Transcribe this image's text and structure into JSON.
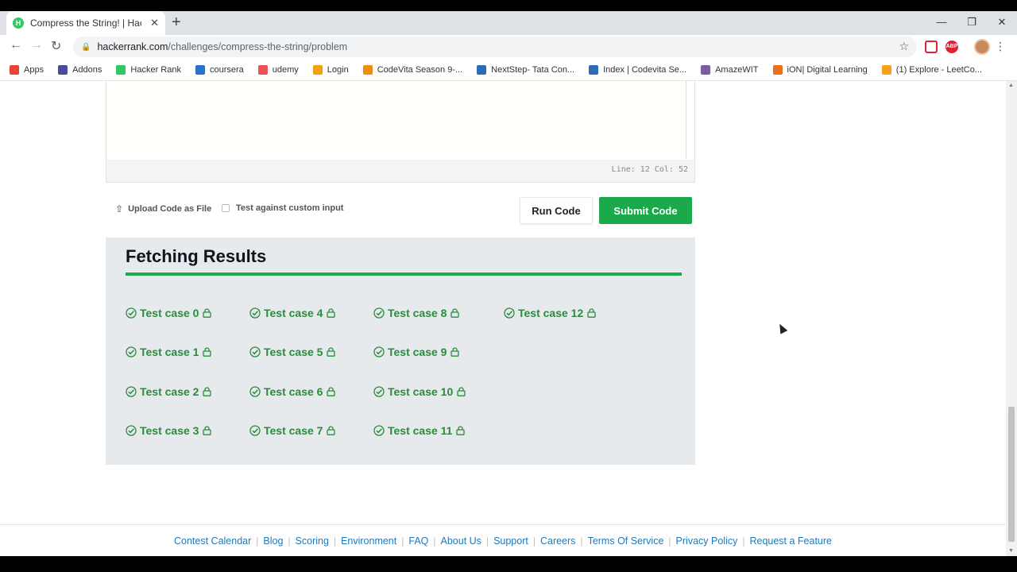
{
  "browser": {
    "tab_title": "Compress the String! | HackerRank",
    "favicon_letter": "H",
    "new_tab": "+",
    "close_tab": "✕",
    "url_host": "hackerrank.com",
    "url_path": "/challenges/compress-the-string/problem",
    "extensions": [
      "ABP"
    ]
  },
  "bookmarks": [
    {
      "label": "Apps",
      "icon": "apps-grid-icon",
      "color": "#e94335"
    },
    {
      "label": "Addons",
      "icon": "addons-icon",
      "color": "#4a4a9a"
    },
    {
      "label": "Hacker Rank",
      "icon": "hackerrank-icon",
      "color": "#2ec866"
    },
    {
      "label": "coursera",
      "icon": "coursera-icon",
      "color": "#2a73cc"
    },
    {
      "label": "udemy",
      "icon": "udemy-icon",
      "color": "#ec5252"
    },
    {
      "label": "Login",
      "icon": "login-icon",
      "color": "#f2a10c"
    },
    {
      "label": "CodeVita Season 9-...",
      "icon": "codevita-icon",
      "color": "#f28c0c"
    },
    {
      "label": "NextStep- Tata Con...",
      "icon": "tcs-icon",
      "color": "#2a6bb5"
    },
    {
      "label": "Index | Codevita Se...",
      "icon": "codevita-index-icon",
      "color": "#2a6bb5"
    },
    {
      "label": "AmazeWIT",
      "icon": "amazewit-icon",
      "color": "#7b5ea7"
    },
    {
      "label": "iON| Digital Learning",
      "icon": "ion-icon",
      "color": "#e8711a"
    },
    {
      "label": "(1) Explore - LeetCo...",
      "icon": "leetcode-icon",
      "color": "#f89f1b"
    }
  ],
  "editor": {
    "status": "Line: 12 Col: 52"
  },
  "actions": {
    "upload_label": "Upload Code as File",
    "custom_input_label": "Test against custom input",
    "run_label": "Run Code",
    "submit_label": "Submit Code"
  },
  "results": {
    "title": "Fetching Results",
    "test_cases": [
      "Test case 0",
      "Test case 1",
      "Test case 2",
      "Test case 3",
      "Test case 4",
      "Test case 5",
      "Test case 6",
      "Test case 7",
      "Test case 8",
      "Test case 9",
      "Test case 10",
      "Test case 11",
      "Test case 12"
    ]
  },
  "footer": {
    "links": [
      "Contest Calendar",
      "Blog",
      "Scoring",
      "Environment",
      "FAQ",
      "About Us",
      "Support",
      "Careers",
      "Terms Of Service",
      "Privacy Policy",
      "Request a Feature"
    ],
    "separator": "|"
  },
  "colors": {
    "accent_green": "#1ba94c",
    "test_case_green": "#2b8a3e",
    "link_blue": "#1f7ab8"
  }
}
